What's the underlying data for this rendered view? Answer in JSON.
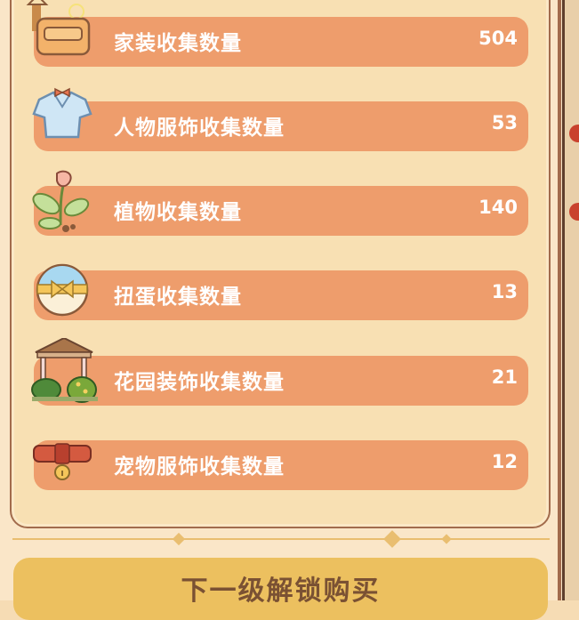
{
  "collections": [
    {
      "label": "家装收集数量",
      "value": "504",
      "icon": "sofa-icon"
    },
    {
      "label": "人物服饰收集数量",
      "value": "53",
      "icon": "shirt-icon"
    },
    {
      "label": "植物收集数量",
      "value": "140",
      "icon": "plant-icon"
    },
    {
      "label": "扭蛋收集数量",
      "value": "13",
      "icon": "gacha-egg-icon"
    },
    {
      "label": "花园装饰收集数量",
      "value": "21",
      "icon": "gazebo-icon"
    },
    {
      "label": "宠物服饰收集数量",
      "value": "12",
      "icon": "pet-collar-icon"
    }
  ],
  "unlock_button": {
    "label": "下一级解锁购买"
  },
  "colors": {
    "row": "#ee9d6c",
    "button": "#ecc05f",
    "panel": "#f8e0b3"
  }
}
